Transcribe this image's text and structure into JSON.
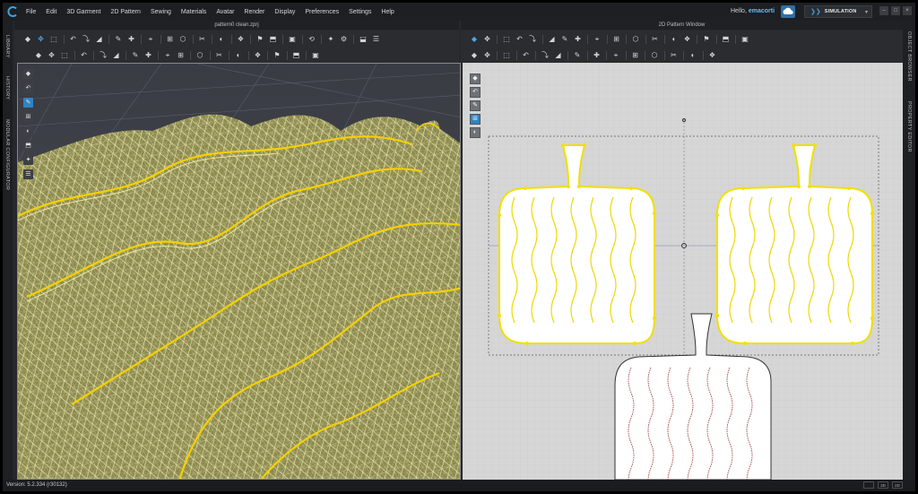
{
  "menubar": {
    "items": [
      "File",
      "Edit",
      "3D Garment",
      "2D Pattern",
      "Sewing",
      "Materials",
      "Avatar",
      "Render",
      "Display",
      "Preferences",
      "Settings",
      "Help"
    ],
    "greeting": "Hello,",
    "username": "emacorti",
    "mode_label": "SIMULATION",
    "window_controls": [
      "–",
      "□",
      "×"
    ]
  },
  "left_sidebar": {
    "tabs": [
      "LIBRARY",
      "HISTORY",
      "MODULAR CONFIGURATOR"
    ]
  },
  "right_sidebar": {
    "tabs": [
      "OBJECT BROWSER",
      "PROPERTY EDITOR"
    ]
  },
  "panel_3d": {
    "title": "pattern0 clean.zprj"
  },
  "panel_2d": {
    "title": "2D Pattern Window"
  },
  "status": {
    "version": "Version: 5.2.334 (r30132)",
    "buttons": [
      "",
      "3D",
      "2D"
    ]
  },
  "colors": {
    "accent": "#3da2e0",
    "mesh_fill": "#8c8a4e",
    "mesh_line": "#f4f0b4",
    "seam": "#f5d000",
    "pattern_bg": "#d6d6d6",
    "pattern_outline": "#f0e000"
  },
  "icons": {
    "toolbar_3d_row1": [
      "avatar-select-icon",
      "move-icon",
      "transform-icon",
      "sep",
      "fold-icon",
      "fold-arrange-icon",
      "fold-angle-icon",
      "sep",
      "pin-icon",
      "pin-box-icon",
      "sep",
      "tack-icon",
      "sep",
      "measure-icon",
      "measure-length-icon",
      "sep",
      "steam-icon",
      "sep",
      "shrink-icon",
      "sep",
      "brush-icon",
      "sep",
      "zipper-icon",
      "button-icon",
      "sep",
      "hanger-icon",
      "sep",
      "arrange-icon",
      "sep",
      "strap-icon",
      "skin-icon",
      "sep",
      "bend-icon",
      "hang-icon"
    ],
    "toolbar_3d_row2": [
      "puckering-icon",
      "seam-icon",
      "fabric-icon",
      "sep",
      "flip-icon",
      "sep",
      "topstitch-icon",
      "glue-icon",
      "sep",
      "graphic-icon",
      "texture-icon",
      "sep",
      "trim-icon",
      "button-hole-icon",
      "sep",
      "solid-icon",
      "sep",
      "tape-icon",
      "sep",
      "fit-icon",
      "sep",
      "snapshot-icon",
      "sep",
      "ruler-icon",
      "sep",
      "arrange-3d-icon",
      "sep",
      "pleat-icon"
    ],
    "toolbar_2d_row1": [
      "transform-pattern-icon",
      "edit-point-icon",
      "sep",
      "polygon-icon",
      "rectangle-icon",
      "circle-icon",
      "sep",
      "internal-polygon-icon",
      "internal-rect-icon",
      "internal-circle-icon",
      "sep",
      "dart-icon",
      "sep",
      "trace-icon",
      "sep",
      "slash-icon",
      "sep",
      "fold-line-icon",
      "sep",
      "text-icon",
      "text-size-icon",
      "sep",
      "grade-icon",
      "sep",
      "symmetric-icon",
      "sep",
      "avatar-2d-icon"
    ],
    "toolbar_2d_row2": [
      "curve-point-icon",
      "add-point-icon",
      "sep",
      "notch-icon",
      "sep",
      "segment-icon",
      "sep",
      "sewing-seg-icon",
      "sewing-free-icon",
      "sep",
      "check-sewing-icon",
      "sep",
      "gather-icon",
      "sep",
      "pleat-2d-icon",
      "sep",
      "topstitch-2d-icon",
      "sep",
      "style-line-icon",
      "sep",
      "graphic-2d-icon",
      "sep",
      "trace-2d-icon",
      "sep",
      "arrange-2d-icon"
    ],
    "view3d_tools": [
      "render-icon",
      "avatar-icon",
      "avatar-pose-icon",
      "avatar-skin-icon",
      "fabric-view-icon",
      "pattern-view-icon",
      "avatar-hide-icon",
      "skeleton-icon"
    ],
    "view2d_tools": [
      "snap-icon",
      "grid-icon",
      "texture-2d-icon",
      "fabric-2d-icon",
      "pattern-display-icon"
    ]
  }
}
